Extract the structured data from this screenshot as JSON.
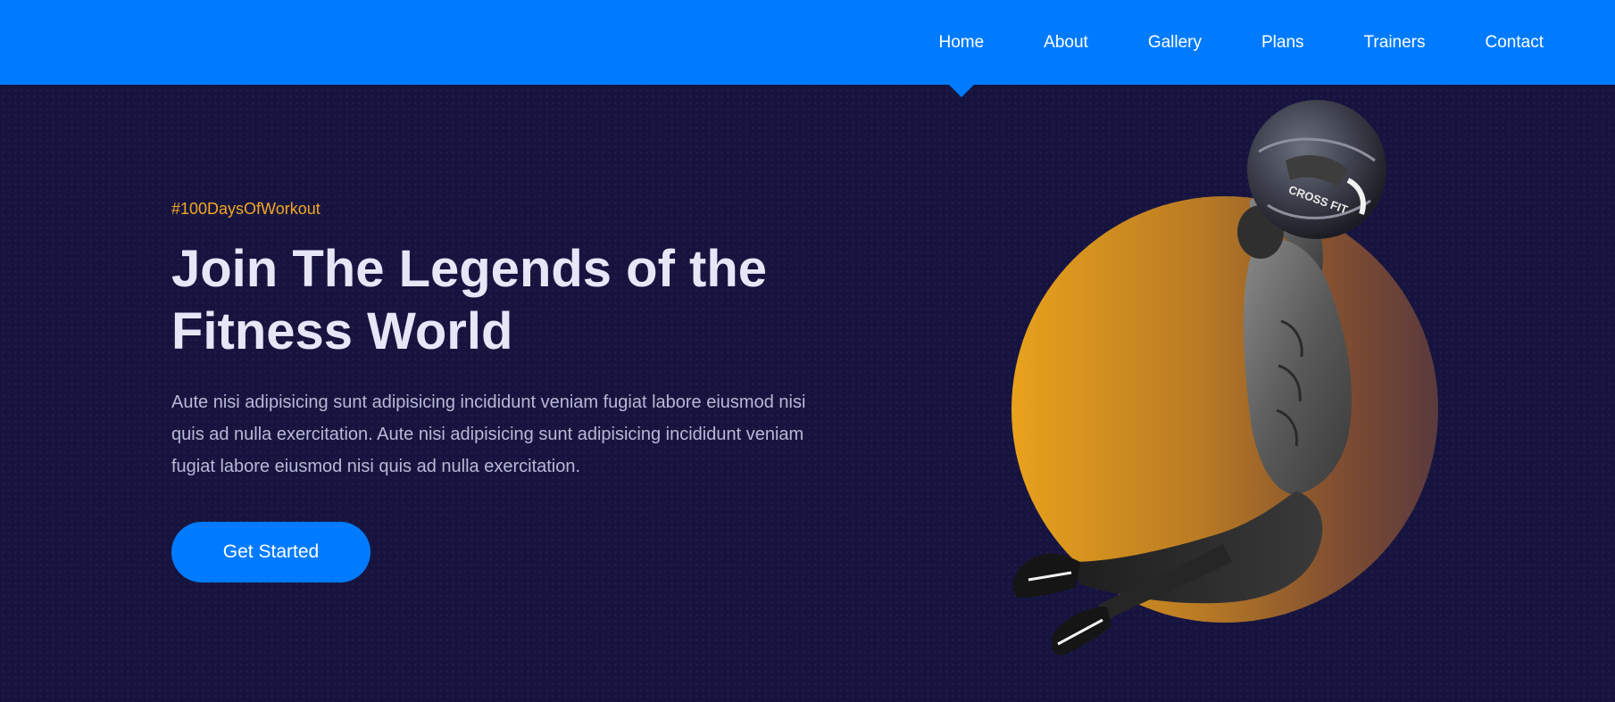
{
  "nav": {
    "items": [
      {
        "label": "Home",
        "active": true
      },
      {
        "label": "About",
        "active": false
      },
      {
        "label": "Gallery",
        "active": false
      },
      {
        "label": "Plans",
        "active": false
      },
      {
        "label": "Trainers",
        "active": false
      },
      {
        "label": "Contact",
        "active": false
      }
    ]
  },
  "hero": {
    "tagline": "#100DaysOfWorkout",
    "headline": "Join The Legends of the Fitness World",
    "description": "Aute nisi adipisicing sunt adipisicing incididunt veniam fugiat labore eiusmod nisi quis ad nulla exercitation. Aute nisi adipisicing sunt adipisicing incididunt veniam fugiat labore eiusmod nisi quis ad nulla exercitation.",
    "cta_label": "Get Started",
    "ball_text": "CROSS FIT"
  },
  "colors": {
    "navbar": "#007bff",
    "background": "#16143f",
    "accent_orange": "#f5a623",
    "headline": "#e6e6f7",
    "body_text": "#b9b8d6",
    "button": "#007bff"
  }
}
